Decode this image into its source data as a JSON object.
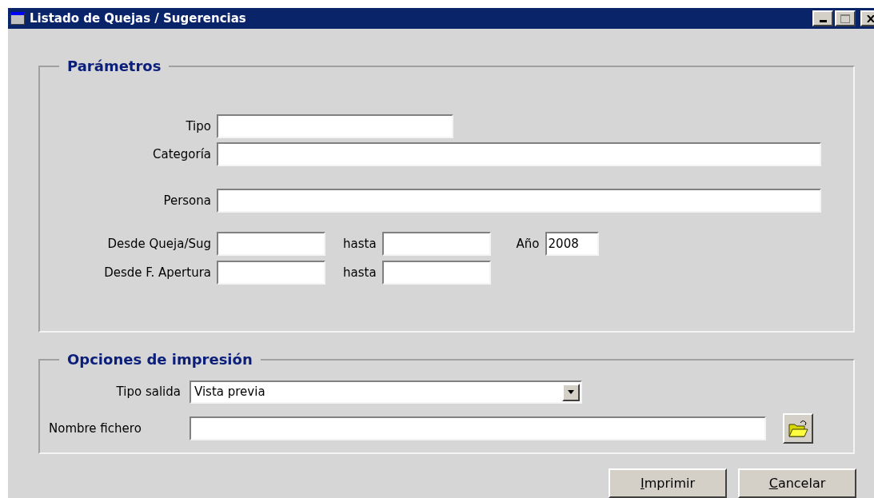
{
  "window": {
    "title": "Listado de Quejas / Sugerencias"
  },
  "parameters": {
    "title": "Parámetros",
    "rows": [
      {
        "fields": [
          {
            "label": "Tipo",
            "kind": "medium"
          }
        ]
      },
      {
        "fields": [
          {
            "label": "Categoría",
            "kind": "wide"
          }
        ]
      },
      {
        "fields": [
          {
            "label": "Persona",
            "kind": "wide"
          }
        ]
      },
      {
        "fields": [
          {
            "label": "Desde Queja/Sug",
            "kind": "short"
          },
          {
            "label": "hasta",
            "kind": "short"
          },
          {
            "label": "Año",
            "kind": "year",
            "value": "2008"
          }
        ]
      },
      {
        "fields": [
          {
            "label": "Desde F. Apertura",
            "kind": "short"
          },
          {
            "label": "hasta",
            "kind": "short"
          }
        ]
      }
    ]
  },
  "print_options": {
    "title": "Opciones de impresión",
    "rows": [
      {
        "kind": "select",
        "label": "Tipo salida",
        "value": "Vista previa"
      },
      {
        "kind": "file",
        "label": "Nombre fichero"
      }
    ]
  },
  "buttons": [
    {
      "label": "Imprimir"
    },
    {
      "label": "Cancelar"
    }
  ]
}
